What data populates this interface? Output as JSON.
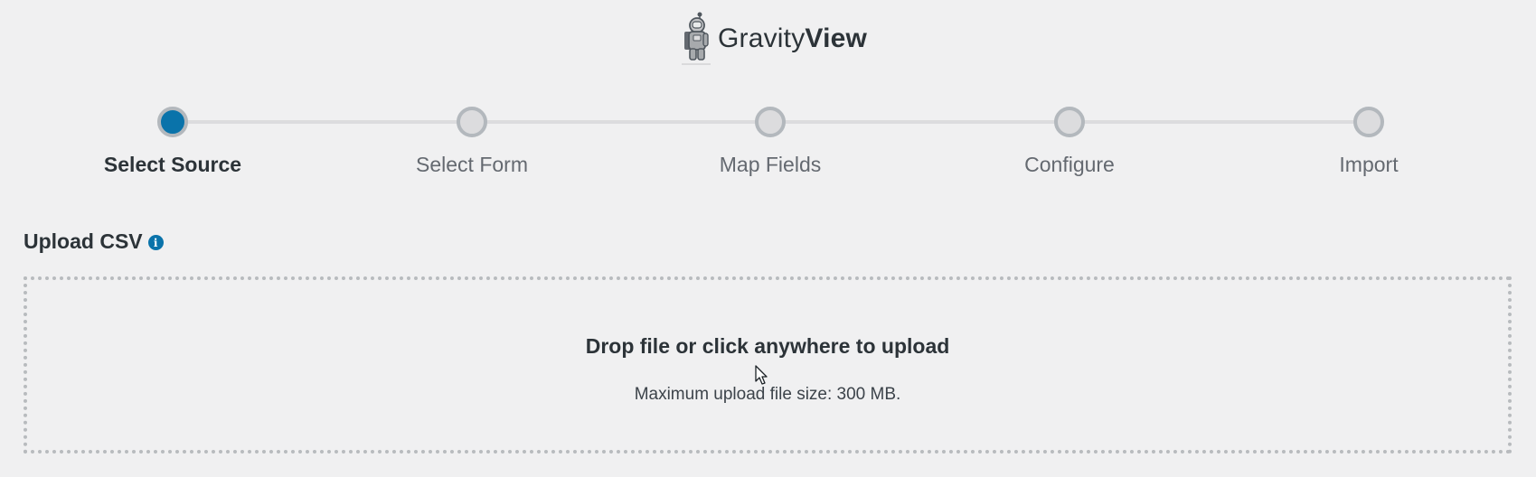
{
  "brand": {
    "name_light": "Gravity",
    "name_bold": "View",
    "logo_icon": "astronaut-logo"
  },
  "stepper": {
    "active_color": "#0a73aa",
    "steps": [
      {
        "label": "Select Source",
        "active": true
      },
      {
        "label": "Select Form",
        "active": false
      },
      {
        "label": "Map Fields",
        "active": false
      },
      {
        "label": "Configure",
        "active": false
      },
      {
        "label": "Import",
        "active": false
      }
    ]
  },
  "upload": {
    "title": "Upload CSV",
    "info_icon": "info-icon",
    "dropzone_title": "Drop file or click anywhere to upload",
    "dropzone_subtitle": "Maximum upload file size: 300 MB."
  }
}
